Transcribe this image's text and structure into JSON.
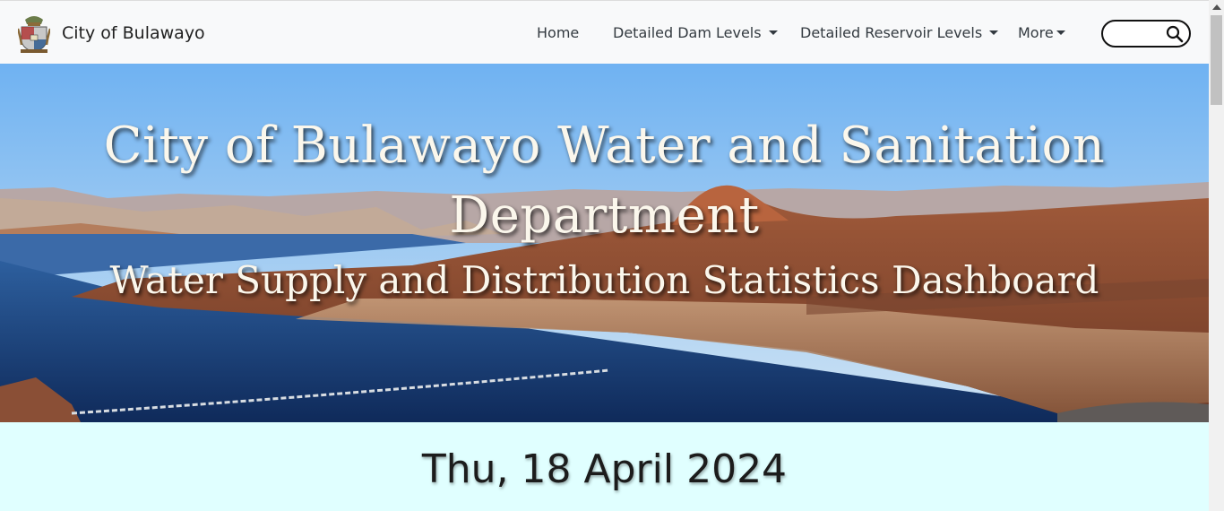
{
  "brand": {
    "name": "City of Bulawayo",
    "logo": "city-crest-logo"
  },
  "nav": {
    "home": "Home",
    "dam_levels": "Detailed Dam Levels",
    "reservoir_levels": "Detailed Reservoir Levels",
    "more": "More"
  },
  "search": {
    "value": "",
    "placeholder": "",
    "icon": "search-icon"
  },
  "hero": {
    "title": "City of Bulawayo Water and Sanitation Department",
    "subtitle": "Water Supply and Distribution Statistics Dashboard"
  },
  "date": "Thu, 18 April 2024",
  "colors": {
    "navbar_bg": "#f8f9fa",
    "page_bg": "#e0ffff",
    "hero_text": "#fbf7ec",
    "lake": "#1b3f7a"
  }
}
